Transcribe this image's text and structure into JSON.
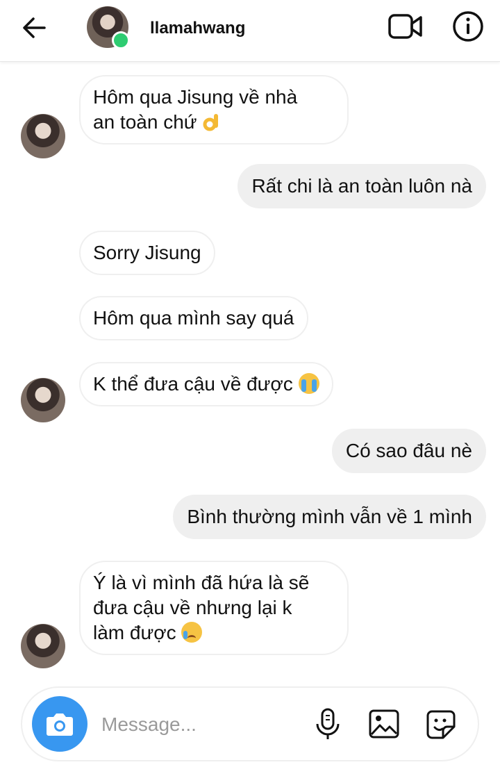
{
  "header": {
    "username": "llamahwang",
    "online": true,
    "icons": {
      "back": "arrow-left-icon",
      "video": "video-camera-icon",
      "info": "info-icon"
    }
  },
  "messages": [
    {
      "from": "them",
      "text": "Hôm qua Jisung về nhà",
      "text2": "an toàn chứ",
      "emoji": "ok-hand"
    },
    {
      "from": "me",
      "text": "Rất chi là an toàn luôn nà"
    },
    {
      "from": "them",
      "text": "Sorry Jisung"
    },
    {
      "from": "them",
      "text": "Hôm qua mình say quá"
    },
    {
      "from": "them",
      "text": "K thể đưa cậu về được",
      "emoji": "loudly-crying-face"
    },
    {
      "from": "me",
      "text": "Có sao đâu nè"
    },
    {
      "from": "me",
      "text": "Bình thường mình vẫn về 1 mình"
    },
    {
      "from": "them",
      "text": "Ý là vì mình đã hứa là sẽ",
      "text2": "đưa cậu về nhưng lại k",
      "text3": "làm được",
      "emoji": "crying-face"
    }
  ],
  "composer": {
    "placeholder": "Message...",
    "icons": {
      "camera": "camera-icon",
      "mic": "microphone-icon",
      "gallery": "image-icon",
      "sticker": "sticker-icon"
    }
  },
  "colors": {
    "accent": "#3897f0",
    "online": "#2ecc71",
    "outgoing_bubble": "#efefef"
  }
}
